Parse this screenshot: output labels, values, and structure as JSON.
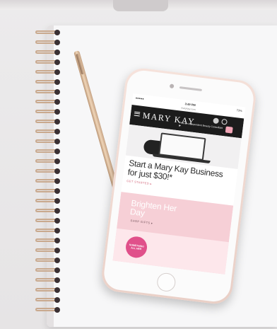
{
  "phone": {
    "status": {
      "time": "3:49 PM",
      "battery": "73%"
    },
    "url": "marykay.com",
    "header": {
      "brand": "MARY KAY",
      "consultant_text": "Find an Independent Beauty Consultant ▶"
    },
    "hero": {
      "headline_line1": "Start a Mary Kay Business",
      "headline_line2": "for just $30!*",
      "cta": "GET STARTED ▸"
    },
    "promo": {
      "title_line1": "Brighten Her",
      "title_line2": "Day",
      "cta": "SHOP GIFTS ▸",
      "badge_line1": "SOMETHING",
      "badge_line2": "ALL HER"
    }
  },
  "colors": {
    "header_bg": "#1c1c1c",
    "promo_pink": "#f6cfd6",
    "badge_pink": "#e0508a",
    "phone_rose_gold": "#f0d8d0"
  },
  "icons": [
    "menu-icon",
    "user-icon",
    "search-icon",
    "bag-icon",
    "home-button",
    "pen",
    "spiral-binding"
  ]
}
